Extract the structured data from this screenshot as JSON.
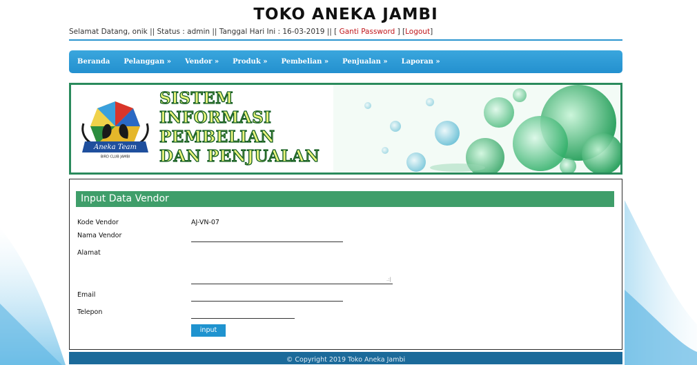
{
  "site": {
    "title": "TOKO ANEKA JAMBI"
  },
  "welcome": {
    "prefix": "Selamat Datang, onik || Status : admin || Tanggal Hari Ini : 16-03-2019 || [ ",
    "change_password": "Ganti Password",
    "middle": " ] [",
    "logout": "Logout",
    "suffix": "]"
  },
  "nav": {
    "items": [
      {
        "label": "Beranda"
      },
      {
        "label": "Pelanggan »"
      },
      {
        "label": "Vendor »"
      },
      {
        "label": "Produk »"
      },
      {
        "label": "Pembelian »"
      },
      {
        "label": "Penjualan »"
      },
      {
        "label": "Laporan »"
      }
    ]
  },
  "banner": {
    "lines": [
      "SISTEM",
      "INFORMASI",
      "PEMBELIAN",
      "DAN PENJUALAN"
    ],
    "logo_text": "Aneka Team",
    "logo_subtext": "BIRD CLUB JAMBI"
  },
  "form": {
    "title": "Input Data Vendor",
    "fields": {
      "kode_label": "Kode Vendor",
      "kode_value": "AJ-VN-07",
      "nama_label": "Nama Vendor",
      "nama_value": "",
      "alamat_label": "Alamat",
      "alamat_value": "",
      "email_label": "Email",
      "email_value": "",
      "telepon_label": "Telepon",
      "telepon_value": ""
    },
    "submit_label": "input"
  },
  "footer": {
    "text": "© Copyright 2019 Toko Aneka Jambi"
  },
  "colors": {
    "accent_blue": "#2a95cf",
    "form_header_green": "#3f9e6a",
    "link_red": "#c0161b",
    "footer_blue": "#1b6a9a"
  }
}
